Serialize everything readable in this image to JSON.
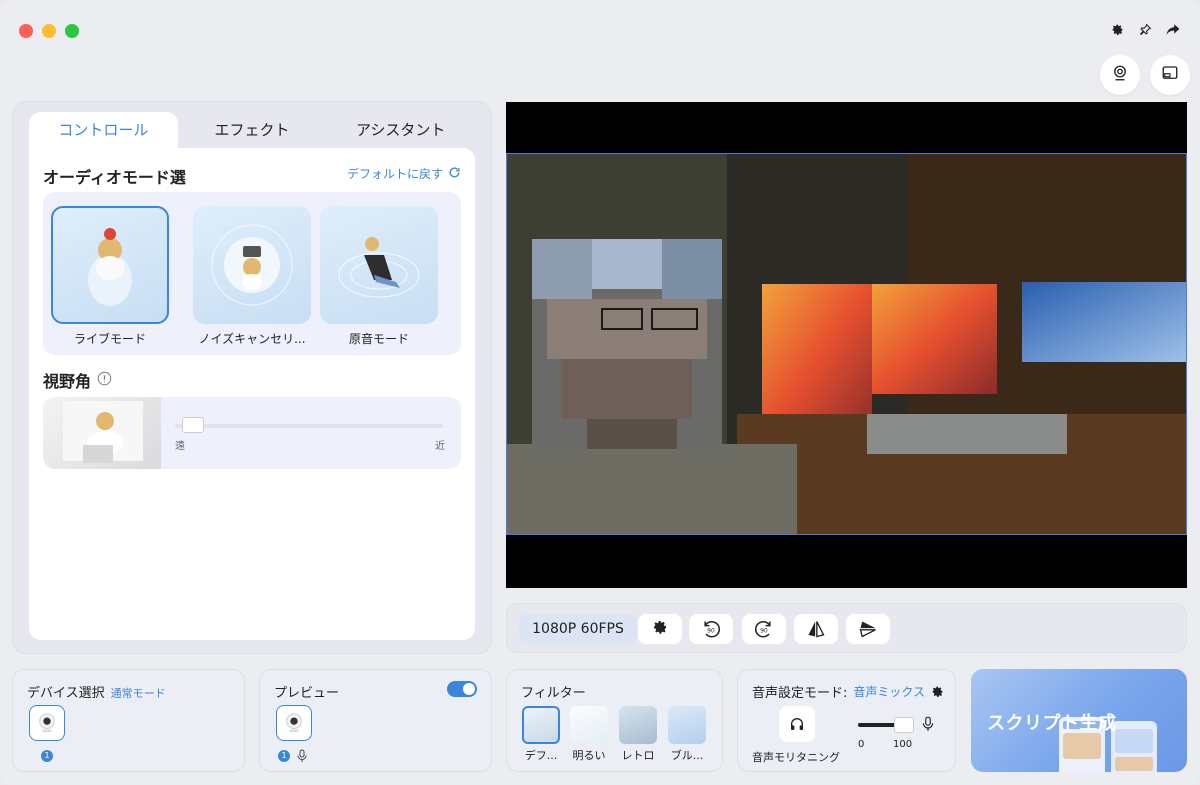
{
  "window": {
    "controls": [
      "close",
      "minimize",
      "maximize"
    ],
    "top_icons": [
      "gear-icon",
      "pin-icon",
      "share-icon"
    ],
    "round_buttons": [
      "webcam-icon",
      "screen-icon"
    ]
  },
  "left_panel": {
    "tabs": [
      {
        "label": "コントロール",
        "active": true
      },
      {
        "label": "エフェクト",
        "active": false
      },
      {
        "label": "アシスタント",
        "active": false
      }
    ],
    "audio_mode": {
      "title": "オーディオモード選",
      "reset_label": "デフォルトに戻す",
      "modes": [
        {
          "label": "ライブモード",
          "selected": true
        },
        {
          "label": "ノイズキャンセリ...",
          "selected": false
        },
        {
          "label": "原音モード",
          "selected": false
        }
      ]
    },
    "fov": {
      "title": "視野角",
      "min_label": "遠",
      "max_label": "近",
      "value_fraction": 0.03
    }
  },
  "controls": {
    "resolution": "1080P 60FPS",
    "buttons": [
      "settings-icon",
      "rotate-left-90-icon",
      "rotate-right-90-icon",
      "flip-horizontal-icon",
      "flip-vertical-icon"
    ],
    "rotate_left_text": "90",
    "rotate_right_text": "90"
  },
  "device_card": {
    "title": "デバイス選択",
    "mode": "通常モード",
    "count": "1"
  },
  "preview_card": {
    "title": "プレビュー",
    "count": "1",
    "enabled": true
  },
  "filter_card": {
    "title": "フィルター",
    "filters": [
      {
        "label": "デフ...",
        "selected": true
      },
      {
        "label": "明るい",
        "selected": false
      },
      {
        "label": "レトロ",
        "selected": false
      },
      {
        "label": "ブル...",
        "selected": false
      }
    ]
  },
  "audio_card": {
    "title": "音声設定モード:",
    "mode": "音声ミックス",
    "monitor_label": "音声モリタニング",
    "volume_min": "0",
    "volume_max": "100",
    "volume_fraction": 0.95
  },
  "script_card": {
    "label": "スクリプト生成"
  },
  "colors": {
    "accent": "#3a86d8",
    "panel": "#e7e8ef",
    "video_border": "#4a7be0"
  }
}
